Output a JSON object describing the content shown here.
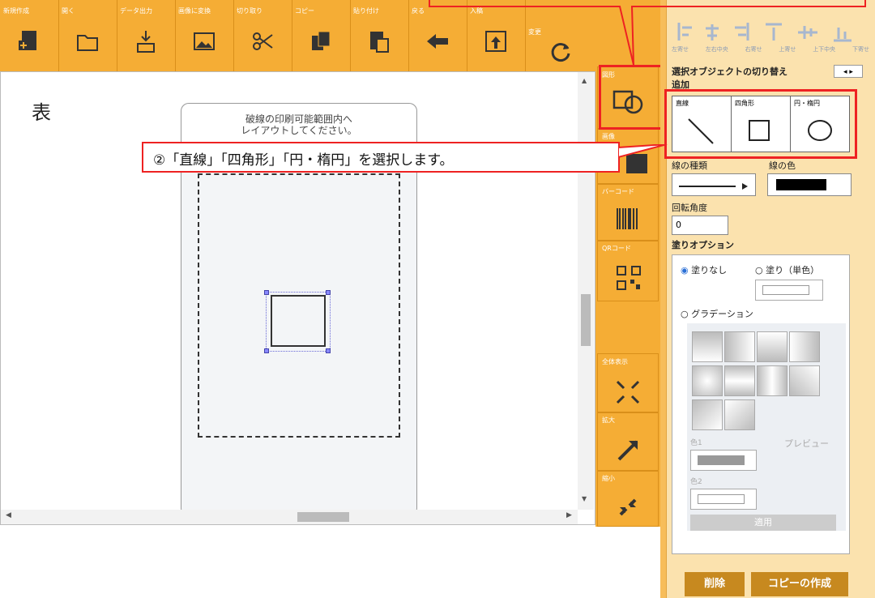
{
  "toolbar": {
    "items": [
      {
        "label": "新規作成",
        "icon": "new-document-icon"
      },
      {
        "label": "開く",
        "icon": "open-folder-icon"
      },
      {
        "label": "データ出力",
        "icon": "data-export-icon"
      },
      {
        "label": "画像に変換",
        "icon": "image-convert-icon"
      },
      {
        "label": "切り取り",
        "icon": "scissors-icon"
      },
      {
        "label": "コピー",
        "icon": "copy-icon"
      },
      {
        "label": "貼り付け",
        "icon": "paste-icon"
      },
      {
        "label": "戻る",
        "icon": "back-arrow-icon"
      },
      {
        "label": "入稿",
        "icon": "submit-icon"
      },
      {
        "label": "変更",
        "icon": "refresh-icon"
      }
    ]
  },
  "canvas": {
    "side_label": "表",
    "print_notice_line1": "破線の印刷可能範囲内へ",
    "print_notice_line2": "レイアウトしてください。"
  },
  "sidebar": {
    "shape_label": "図形",
    "image_label": "画像",
    "barcode_label": "バーコード",
    "qrcode_label": "QRコード",
    "fit_label": "全体表示",
    "zoom_in_label": "拡大",
    "zoom_out_label": "縮小"
  },
  "callout": {
    "text": "②「直線」「四角形」「円・楕円」を選択します。"
  },
  "panel": {
    "align_labels": [
      "左寄せ",
      "左右中央",
      "右寄せ",
      "上寄せ",
      "上下中央",
      "下寄せ"
    ],
    "switch_label": "選択オブジェクトの切り替え",
    "add_label": "追加",
    "shape_options": [
      "直線",
      "四角形",
      "円・楕円"
    ],
    "line_type_label": "線の種類",
    "line_color_label": "線の色",
    "rotation_label": "回転角度",
    "rotation_value": "0",
    "fill_option_label": "塗りオプション",
    "fill_none": "塗りなし",
    "fill_solid": "塗り（単色）",
    "gradation": "グラデーション",
    "color1": "色1",
    "color2": "色2",
    "preview": "プレビュー",
    "apply": "適用",
    "delete": "削除",
    "copy_create": "コピーの作成"
  },
  "colors": {
    "accent": "#f5ad35",
    "highlight": "#e22222"
  }
}
